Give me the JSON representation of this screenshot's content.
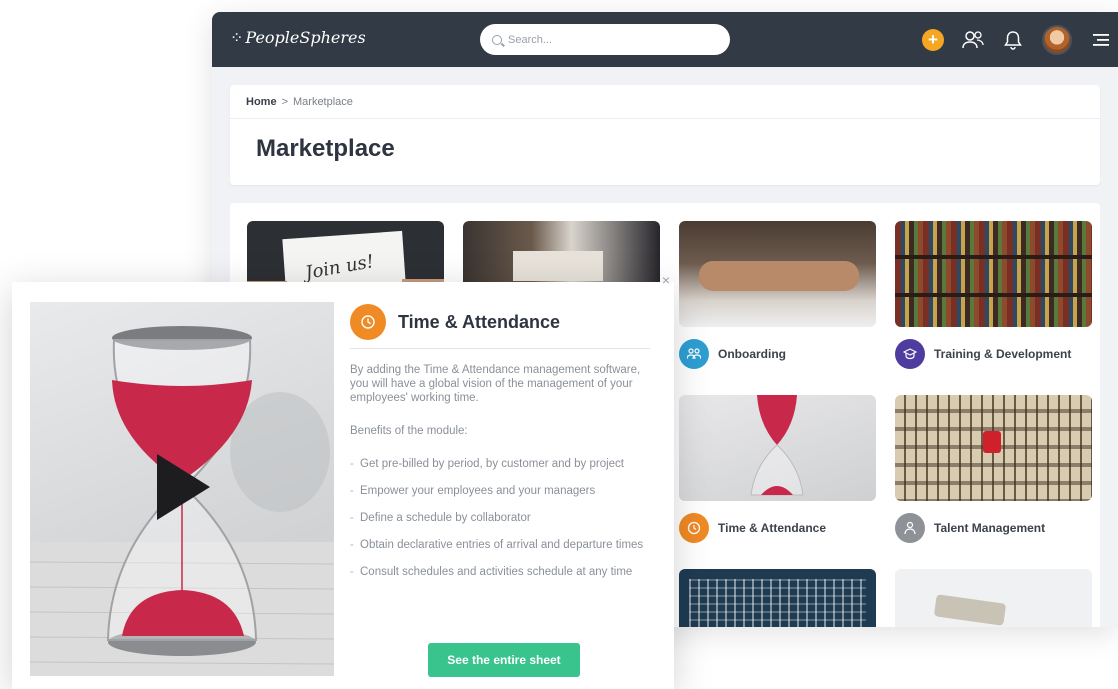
{
  "topbar": {
    "brand": "PeopleSpheres",
    "search_placeholder": "Search...",
    "icons": [
      "add-icon",
      "users-icon",
      "bell-icon",
      "avatar",
      "menu-icon"
    ],
    "accent": "#f5a623"
  },
  "breadcrumb": {
    "home": "Home",
    "separator": ">",
    "current": "Marketplace"
  },
  "page_title": "Marketplace",
  "tiles": [
    {
      "label": "",
      "icon": "",
      "color": ""
    },
    {
      "label": "",
      "icon": "",
      "color": ""
    },
    {
      "label": "Onboarding",
      "icon": "onboarding-icon",
      "color": "#2e9fd3"
    },
    {
      "label": "Training & Development",
      "icon": "graduation-icon",
      "color": "#4e3c9e"
    },
    {
      "label": "Time & Attendance",
      "icon": "clock-icon",
      "color": "#f08a24"
    },
    {
      "label": "Talent Management",
      "icon": "talent-icon",
      "color": "#8e9297"
    },
    {
      "label": "",
      "icon": "",
      "color": ""
    },
    {
      "label": "",
      "icon": "",
      "color": ""
    }
  ],
  "tile_images": {
    "tile1_sign": "Join us!"
  },
  "popup": {
    "title": "Time & Attendance",
    "description": "By adding the Time & Attendance management software, you will have a global vision of the management of your employees' working time.",
    "benefits_heading": "Benefits of the module:",
    "benefits": [
      "Get pre-billed by period, by customer and by project",
      "Empower your employees and your managers",
      "Define a schedule by collaborator",
      "Obtain declarative entries of arrival and departure times",
      "Consult schedules and activities schedule at any time"
    ],
    "cta": "See the entire sheet",
    "close": "×",
    "accent": "#f08a24",
    "cta_color": "#39c48e"
  }
}
